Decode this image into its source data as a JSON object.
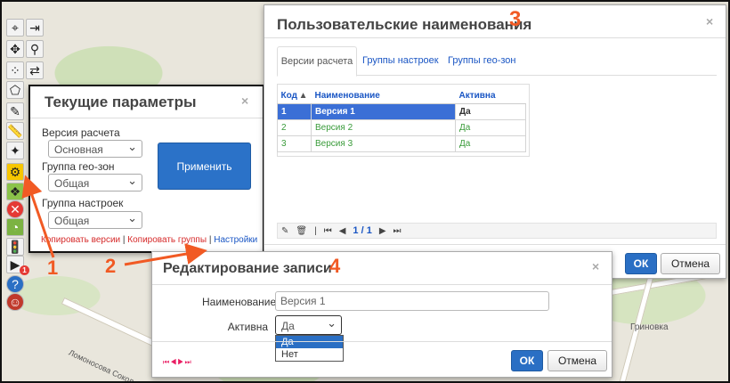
{
  "map": {
    "label_grinivka": "Гриновка",
    "label_street": "Ломоносова Сокол"
  },
  "toolbar": {
    "icons": [
      "crosshair-icon",
      "exit-icon",
      "move-icon",
      "marker-icon",
      "points-icon",
      "swap-icon",
      "polygon-icon",
      "pencil-icon",
      "ruler-icon",
      "wand-icon",
      "bike-icon",
      "layers-icon",
      "close-icon",
      "signal-icon",
      "traffic-light-icon",
      "play-icon",
      "help-icon",
      "user-icon"
    ],
    "badge": "1"
  },
  "params_dialog": {
    "title": "Текущие параметры",
    "close": "×",
    "version_label": "Версия расчета",
    "version_value": "Основная",
    "geo_label": "Группа гео-зон",
    "geo_value": "Общая",
    "settings_label": "Группа настроек",
    "settings_value": "Общая",
    "apply_label": "Применить",
    "link_copy_versions": "Копировать версии",
    "link_copy_groups": "Копировать группы",
    "link_settings": "Настройки",
    "sep": "|"
  },
  "names_dialog": {
    "title": "Пользовательские наименования",
    "close": "×",
    "tabs": [
      "Версии расчета",
      "Группы настроек",
      "Группы гео-зон"
    ],
    "columns": [
      "Код",
      "Наименование",
      "Активна"
    ],
    "rows": [
      {
        "code": "1",
        "name": "Версия 1",
        "active": "Да"
      },
      {
        "code": "2",
        "name": "Версия 2",
        "active": "Да"
      },
      {
        "code": "3",
        "name": "Версия 3",
        "active": "Да"
      }
    ],
    "pager_text": "1 / 1",
    "ok_label": "ОК",
    "cancel_label": "Отмена"
  },
  "edit_dialog": {
    "title": "Редактирование записи",
    "close": "×",
    "name_label": "Наименование",
    "name_value": "Версия 1",
    "active_label": "Активна",
    "active_value": "Да",
    "options": [
      "Да",
      "Нет"
    ],
    "ok_label": "ОК",
    "cancel_label": "Отмена"
  },
  "annotations": {
    "n1": "1",
    "n2": "2",
    "n3": "3",
    "n4": "4",
    "arrow_color": "#f15a24"
  }
}
